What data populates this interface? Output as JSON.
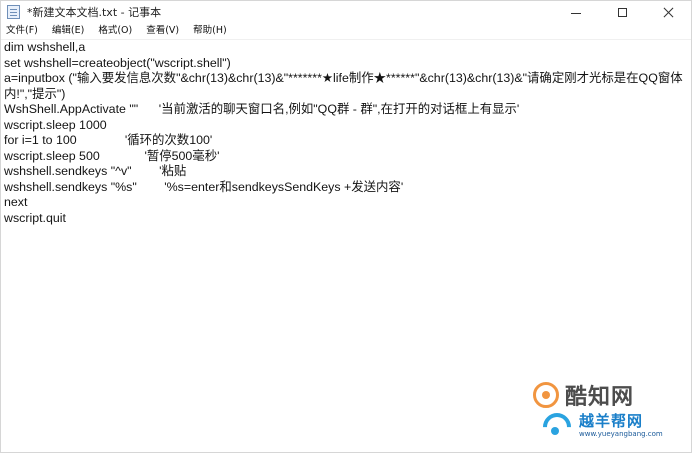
{
  "window": {
    "title": "*新建文本文档.txt - 记事本"
  },
  "menu": {
    "items": [
      "文件(F)",
      "编辑(E)",
      "格式(O)",
      "查看(V)",
      "帮助(H)"
    ]
  },
  "editor": {
    "lines": [
      "dim wshshell,a",
      "set wshshell=createobject(\"wscript.shell\")",
      "a=inputbox (\"输入要发信息次数\"&chr(13)&chr(13)&\"*******★life制作★******\"&chr(13)&chr(13)&\"请确定刚才光标是在QQ窗体",
      "内!\",\"提示\")",
      "WshShell.AppActivate \"\"      '当前激活的聊天窗口名,例如\"QQ群 - 群\",在打开的对话框上有显示'",
      "wscript.sleep 1000",
      "for i=1 to 100              '循环的次数100'",
      "wscript.sleep 500             '暂停500毫秒'",
      "wshshell.sendkeys \"^v\"        '粘贴",
      "wshshell.sendkeys \"%s\"        '%s=enter和sendkeysSendKeys +发送内容'",
      "next",
      "wscript.quit"
    ]
  },
  "watermarks": {
    "kuzhi_text": "酷知网",
    "yue_text": "越羊帮网",
    "yue_url": "www.yueyangbang.com"
  },
  "colors": {
    "text": "#141414",
    "background": "#ffffff",
    "watermark_orange": "#f08a2c",
    "watermark_blue": "#1a7fc9"
  }
}
